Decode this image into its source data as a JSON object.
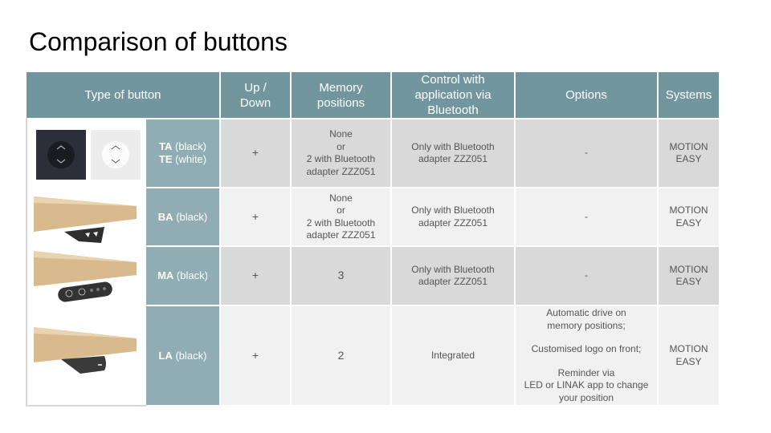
{
  "title": "Comparison of buttons",
  "colors": {
    "header_bg": "#72969e",
    "name_bg": "#91adb4",
    "row_dark": "#d9d9d9",
    "row_light": "#f1f1f1"
  },
  "table": {
    "headers": [
      "Type of button",
      "Up /\nDown",
      "Memory\npositions",
      "Control with\napplication via\nBluetooth",
      "Options",
      "Systems"
    ],
    "rows": [
      {
        "image": "round-button-black-white",
        "code": "TA",
        "color": " (black)",
        "code2": "TE",
        "color2": " (white)",
        "up_down": "+",
        "memory": "None\nor\n2 with Bluetooth\nadapter ZZZ051",
        "control": "Only with Bluetooth\nadapter ZZZ051",
        "options": [
          "-"
        ],
        "systems": "MOTION\nEASY"
      },
      {
        "image": "desk-with-ba-button",
        "code": "BA",
        "color": " (black)",
        "up_down": "+",
        "memory": "None\nor\n2 with Bluetooth\nadapter ZZZ051",
        "control": "Only with Bluetooth\nadapter ZZZ051",
        "options": [
          "-"
        ],
        "systems": "MOTION\nEASY"
      },
      {
        "image": "desk-with-ma-button",
        "code": "MA",
        "color": " (black)",
        "up_down": "+",
        "memory": "3",
        "control": "Only with Bluetooth\nadapter ZZZ051",
        "options": [
          "-"
        ],
        "systems": "MOTION\nEASY"
      },
      {
        "image": "desk-with-la-button",
        "code": "LA",
        "color": " (black)",
        "up_down": "+",
        "memory": "2",
        "control": "Integrated",
        "options": [
          "Automatic drive on\nmemory positions;",
          "Customised logo on front;",
          "Reminder via\nLED or LINAK app to change\nyour position"
        ],
        "systems": "MOTION\nEASY"
      }
    ]
  }
}
